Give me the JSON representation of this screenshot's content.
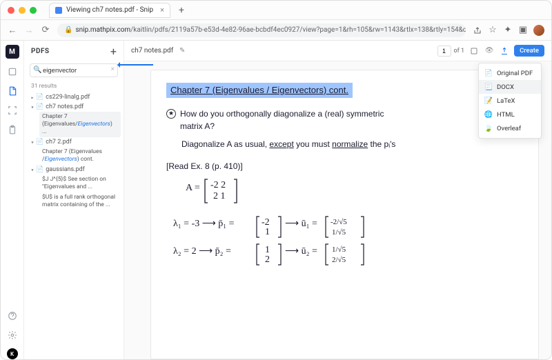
{
  "browser": {
    "tab_title": "Viewing ch7 notes.pdf - Snip",
    "url_host": "snip.mathpix.com",
    "url_path": "/kaitlin/pdfs/2119a57b-e53d-4e82-96ae-bcbdf4ec0927/view?page=1&rh=105&rw=1143&rtlx=138&rtly=154&c..."
  },
  "sidebar": {
    "title": "PDFS",
    "search_value": "eigenvector",
    "search_placeholder": "Search",
    "results_count": "31 results",
    "files": [
      {
        "name": "cs229-linalg.pdf",
        "open": false,
        "matches": []
      },
      {
        "name": "ch7 notes.pdf",
        "open": true,
        "matches": [
          {
            "text": "Chapter 7 (Eigenvalues/",
            "em": "Eigenvectors",
            "tail": ") ...",
            "selected": true
          }
        ]
      },
      {
        "name": "ch7 2.pdf",
        "open": true,
        "matches": [
          {
            "text": "Chapter 7 (Eigenvalues /",
            "em": "Eigenvectors",
            "tail": ") cont.",
            "selected": false
          }
        ]
      },
      {
        "name": "gaussians.pdf",
        "open": true,
        "matches": [
          {
            "text": "$J J^{5}$ See section on \"Eigenvalues and ...",
            "em": "",
            "tail": "",
            "selected": false
          },
          {
            "text": "$U$ is a full rank orthogonal matrix containing of the ...",
            "em": "",
            "tail": "",
            "selected": false
          }
        ]
      }
    ]
  },
  "doc": {
    "filename": "ch7 notes.pdf",
    "page_current": "1",
    "page_label_of": "of 1",
    "create_label": "Create",
    "export_menu": [
      {
        "icon": "pdf-icon",
        "label": "Original PDF"
      },
      {
        "icon": "docx-icon",
        "label": "DOCX"
      },
      {
        "icon": "tex-icon",
        "label": "LaTeX"
      },
      {
        "icon": "html-icon",
        "label": "HTML"
      },
      {
        "icon": "overleaf-icon",
        "label": "Overleaf"
      }
    ]
  },
  "page": {
    "heading": "Chapter 7  (Eigenvalues / Eigenvectors) cont.",
    "question_line1": "How do you orthogonally diagonalize a (real) symmetric",
    "question_line2": "matrix A?",
    "answer_prefix": "Diagonalize A as usual, ",
    "answer_except": "except",
    "answer_mid": " you must ",
    "answer_normalize": "normalize",
    "answer_tail": " the  pᵢ's",
    "read_ex": "Read Ex. 8 (p. 410)",
    "matrix_A": "A = [−2  2; 2  1]",
    "eig1": "λ₁ = −3 → p₁ = [−2;1] → u₁ = [−2/√5; 1/√5]",
    "eig2": "λ₂ =  2 → p₂ = [1;2] → u₂ = [1/√5; 2/√5]"
  }
}
